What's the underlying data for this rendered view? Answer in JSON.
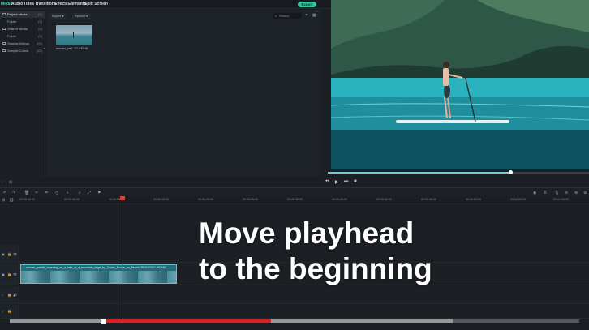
{
  "top_tabs": [
    {
      "label": "Media",
      "active": true
    },
    {
      "label": "Audio",
      "active": false
    },
    {
      "label": "Titles",
      "active": false
    },
    {
      "label": "Transitions",
      "active": false
    },
    {
      "label": "Effects",
      "active": false
    },
    {
      "label": "Elements",
      "active": false
    },
    {
      "label": "Split Screen",
      "active": false
    }
  ],
  "export_label": "Export",
  "library": [
    {
      "label": "Project Media",
      "count": "(1)"
    },
    {
      "label": "Folder",
      "count": "(1)"
    },
    {
      "label": "Shared Media",
      "count": "(0)"
    },
    {
      "label": "Folder",
      "count": "(0)"
    },
    {
      "label": "Sample Videos",
      "count": "(20)"
    },
    {
      "label": "Sample Colors",
      "count": "(15)"
    }
  ],
  "media": {
    "import_label": "Import",
    "record_label": "Record",
    "search_placeholder": "Search",
    "thumb_label": "woman_pad...O UHDHD"
  },
  "timeline": {
    "timecodes": [
      "00:00:00:00",
      "00:00:05:00",
      "00:00:10:00",
      "00:00:15:00",
      "00:00:20:00",
      "00:00:25:00",
      "00:00:30:00",
      "00:00:35:00",
      "00:00:40:00",
      "00:00:45:00",
      "00:00:50:00",
      "00:00:55:00",
      "00:01:00:00",
      "00:01:05:00"
    ],
    "clip_label": "woman_paddle_boarding_on_a_lake_at_a_mountain_ridge_by_Cedric_Brusle_on_Pexels 3840x2160 UHDHD",
    "playhead_fraction": 0.22
  },
  "caption_line1": "Move playhead",
  "caption_line2": "to the beginning",
  "video_progress": {
    "played": 0.29,
    "buffered": 0.78
  },
  "colors": {
    "accent": "#3ed6b8",
    "export": "#33c9a0",
    "playhead": "#d8453a",
    "progress": "#e02020"
  }
}
